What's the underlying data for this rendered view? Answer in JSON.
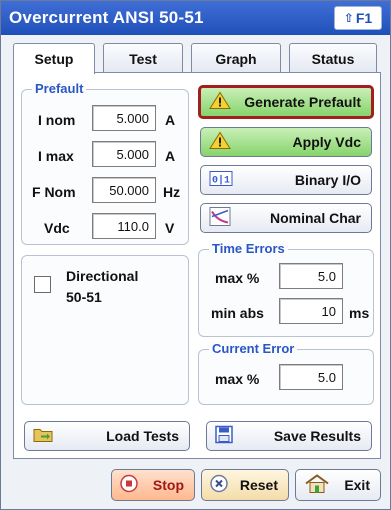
{
  "window": {
    "title": "Overcurrent ANSI 50-51",
    "help_label": "F1"
  },
  "tabs": [
    {
      "label": "Setup",
      "active": true
    },
    {
      "label": "Test",
      "active": false
    },
    {
      "label": "Graph",
      "active": false
    },
    {
      "label": "Status",
      "active": false
    }
  ],
  "prefault": {
    "title": "Prefault",
    "fields": [
      {
        "label": "I nom",
        "value": "5.000",
        "unit": "A"
      },
      {
        "label": "I max",
        "value": "5.000",
        "unit": "A"
      },
      {
        "label": "F Nom",
        "value": "50.000",
        "unit": "Hz"
      },
      {
        "label": "Vdc",
        "value": "110.0",
        "unit": "V"
      }
    ]
  },
  "directional": {
    "label_line1": "Directional",
    "label_line2": "50-51",
    "checked": false
  },
  "actions": {
    "generate_prefault": "Generate Prefault",
    "apply_vdc": "Apply Vdc",
    "binary_io": "Binary I/O",
    "nominal_char": "Nominal Char"
  },
  "time_errors": {
    "title": "Time Errors",
    "max_pct_label": "max %",
    "max_pct_value": "5.0",
    "min_abs_label": "min abs",
    "min_abs_value": "10",
    "min_abs_unit": "ms"
  },
  "current_error": {
    "title": "Current Error",
    "max_pct_label": "max %",
    "max_pct_value": "5.0"
  },
  "files": {
    "load_tests": "Load Tests",
    "save_results": "Save Results"
  },
  "bottom": {
    "stop": "Stop",
    "reset": "Reset",
    "exit": "Exit"
  },
  "colors": {
    "title_bar": "#2a5bc9",
    "group_title": "#2a56c6",
    "green_button": "#86d46b",
    "alert_border": "#a31e1e",
    "stop_button": "#ffc9a6"
  }
}
